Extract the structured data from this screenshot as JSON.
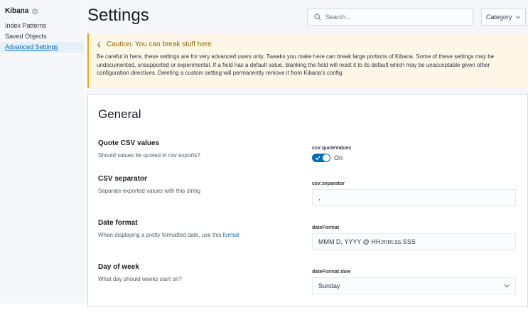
{
  "sidebar": {
    "title": "Kibana",
    "items": [
      {
        "label": "Index Patterns"
      },
      {
        "label": "Saved Objects"
      },
      {
        "label": "Advanced Settings"
      }
    ]
  },
  "header": {
    "title": "Settings",
    "search_placeholder": "Search...",
    "category_label": "Category"
  },
  "callout": {
    "title": "Caution: You can break stuff here",
    "body": "Be careful in here, these settings are for very advanced users only. Tweaks you make here can break large portions of Kibana. Some of these settings may be undocumented, unsupported or experimental. If a field has a default value, blanking the field will reset it to its default which may be unacceptable given other configuration directives. Deleting a custom setting will permanently remove it from Kibana's config."
  },
  "section": {
    "title": "General",
    "settings": [
      {
        "title": "Quote CSV values",
        "desc": "Should values be quoted in csv exports?",
        "key": "csv:quoteValues",
        "toggle_label": "On",
        "toggle_on": true
      },
      {
        "title": "CSV separator",
        "desc": "Separate exported values with this string",
        "key": "csv:separator",
        "value": ","
      },
      {
        "title": "Date format",
        "desc": "When displaying a pretty formatted date, use this",
        "desc_link": "format",
        "key": "dateFormat",
        "value": "MMM D, YYYY @ HH:mm:ss.SSS"
      },
      {
        "title": "Day of week",
        "desc": "What day should weeks start on?",
        "key": "dateFormat:dow",
        "value": "Sunday"
      }
    ]
  },
  "colors": {
    "accent": "#006bb8",
    "warning_bg": "#fef6e6",
    "warning_border": "#f5a700"
  }
}
